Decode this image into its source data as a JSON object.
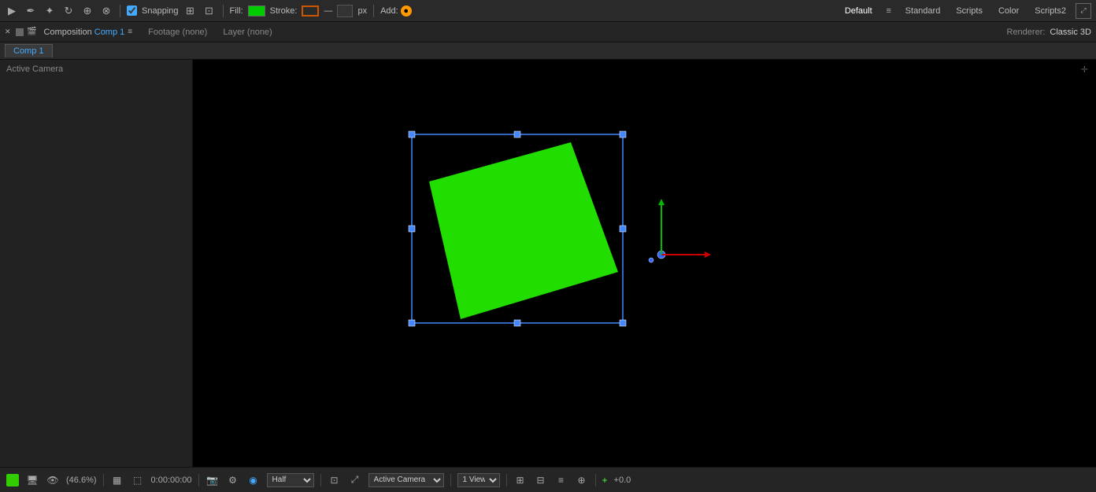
{
  "toolbar": {
    "fill_label": "Fill:",
    "stroke_label": "Stroke:",
    "px_label": "px",
    "add_label": "Add:",
    "fill_color": "#00dd00",
    "snapping_label": "Snapping"
  },
  "nav": {
    "default_label": "Default",
    "standard_label": "Standard",
    "scripts_label": "Scripts",
    "color_label": "Color",
    "scripts2_label": "Scripts2"
  },
  "comp_bar": {
    "composition_label": "Composition",
    "comp_name": "Comp 1",
    "footage_label": "Footage (none)",
    "layer_label": "Layer (none)",
    "renderer_label": "Renderer:",
    "renderer_value": "Classic 3D"
  },
  "comp_tab": {
    "tab_label": "Comp 1"
  },
  "viewport": {
    "active_camera_label": "Active Camera"
  },
  "bottom": {
    "zoom_label": "(46.6%)",
    "timecode": "0:00:00:00",
    "quality_label": "Half",
    "camera_label": "Active Camera",
    "view_label": "1 View",
    "plus_value": "+0.0"
  }
}
